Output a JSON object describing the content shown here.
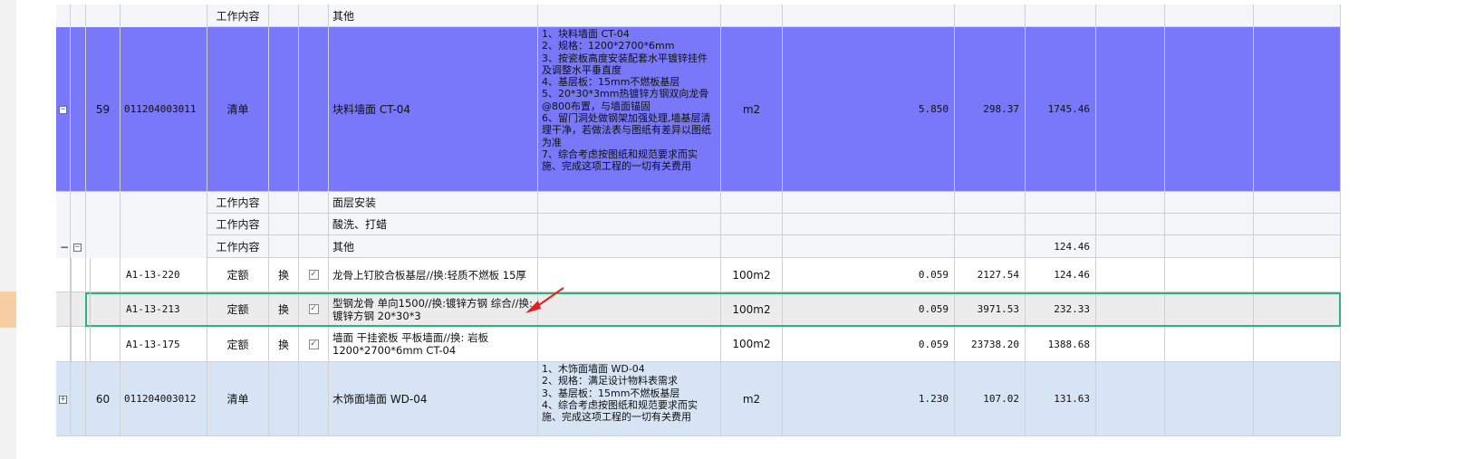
{
  "colors": {
    "selected_row": "#7878f8",
    "collapsed_row": "#d7e4f4",
    "selection_border": "#2db37a",
    "arrow": "#e02020"
  },
  "rows": [
    {
      "id": "r0",
      "type": "content",
      "kind": "工作内容",
      "name": "其他"
    },
    {
      "id": "r59",
      "type": "bill",
      "no": "59",
      "code": "011204003011",
      "kind": "清单",
      "name": "块料墙面 CT-04",
      "desc": "1、块料墙面 CT-04\n2、规格：1200*2700*6mm\n3、按瓷板高度安装配套水平镀锌挂件及调整水平垂直度\n4、基层板：15mm不燃板基层\n5、20*30*3mm热镀锌方钢双向龙骨@800布置，与墙面锚固\n6、留门洞处做钢架加强处理,墙基层清理干净，若做法表与图纸有差异以图纸为准\n7、综合考虑按图纸和规范要求而实施、完成这项工程的一切有关费用",
      "unit": "m2",
      "qty": "5.850",
      "price": "298.37",
      "total": "1745.46",
      "toggle": "−"
    },
    {
      "id": "r1",
      "type": "content",
      "kind": "工作内容",
      "name": "面层安装"
    },
    {
      "id": "r2",
      "type": "content",
      "kind": "工作内容",
      "name": "酸洗、打蜡"
    },
    {
      "id": "r3",
      "type": "content",
      "kind": "工作内容",
      "name": "其他",
      "total": "124.46",
      "toggle": "−"
    },
    {
      "id": "q1",
      "type": "quota",
      "code": "A1-13-220",
      "kind": "定额",
      "swap": "换",
      "check": "✓",
      "name": "龙骨上钉胶合板基层//换:轻质不燃板 15厚",
      "unit": "100m2",
      "qty": "0.059",
      "price": "2127.54",
      "total": "124.46"
    },
    {
      "id": "q2",
      "type": "quota",
      "code": "A1-13-213",
      "kind": "定额",
      "swap": "换",
      "check": "✓",
      "name": "型钢龙骨 单向1500//换:镀锌方钢 综合//换: 镀锌方钢 20*30*3",
      "unit": "100m2",
      "qty": "0.059",
      "price": "3971.53",
      "total": "232.33"
    },
    {
      "id": "q3",
      "type": "quota",
      "code": "A1-13-175",
      "kind": "定额",
      "swap": "换",
      "check": "✓",
      "name": "墙面 干挂瓷板 平板墙面//换: 岩板 1200*2700*6mm CT-04",
      "unit": "100m2",
      "qty": "0.059",
      "price": "23738.20",
      "total": "1388.68"
    },
    {
      "id": "r60",
      "type": "bill",
      "no": "60",
      "code": "011204003012",
      "kind": "清单",
      "name": "木饰面墙面 WD-04",
      "desc": "1、木饰面墙面 WD-04\n2、规格：满足设计物料表需求\n3、基层板：15mm不燃板基层\n4、综合考虑按图纸和规范要求而实施、完成这项工程的一切有关费用",
      "unit": "m2",
      "qty": "1.230",
      "price": "107.02",
      "total": "131.63",
      "toggle": "+"
    }
  ]
}
